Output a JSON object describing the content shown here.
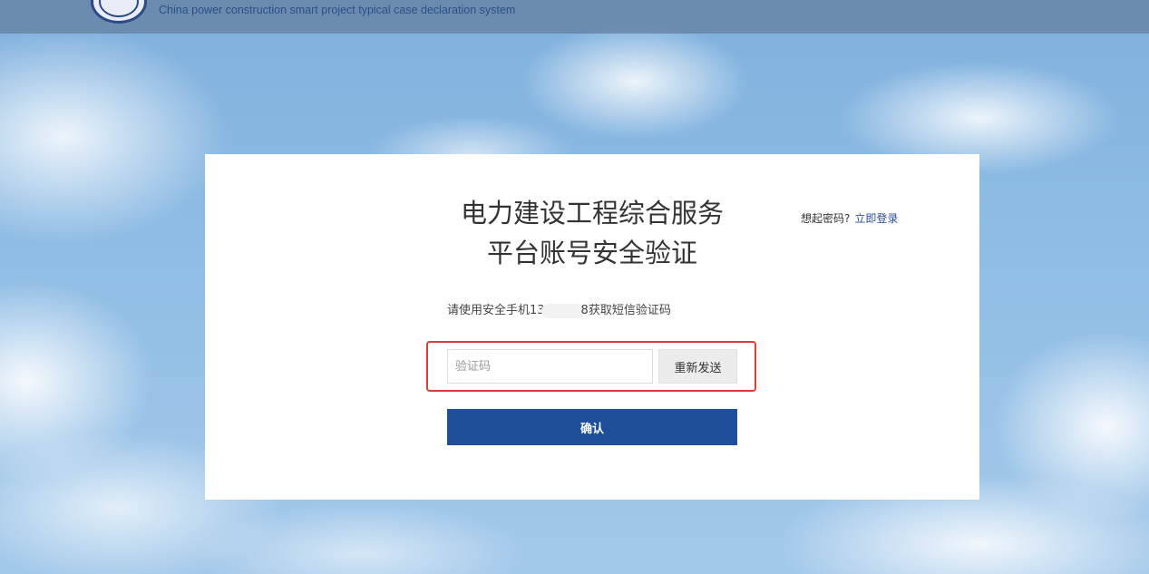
{
  "header": {
    "subtitle_en": "China power construction smart project typical case declaration system"
  },
  "card": {
    "title_line1": "电力建设工程综合服务",
    "title_line2": "平台账号安全验证",
    "remember_prompt": "想起密码?",
    "login_link": "立即登录",
    "phone_hint_prefix": "请使用安全手机13",
    "phone_hint_suffix": "8获取短信验证码",
    "code_input": {
      "placeholder": "验证码",
      "value": ""
    },
    "resend_label": "重新发送",
    "confirm_label": "确认"
  },
  "colors": {
    "primary_button": "#1f4f9b",
    "link": "#2a4f95",
    "highlight_border": "#e23a2e"
  }
}
